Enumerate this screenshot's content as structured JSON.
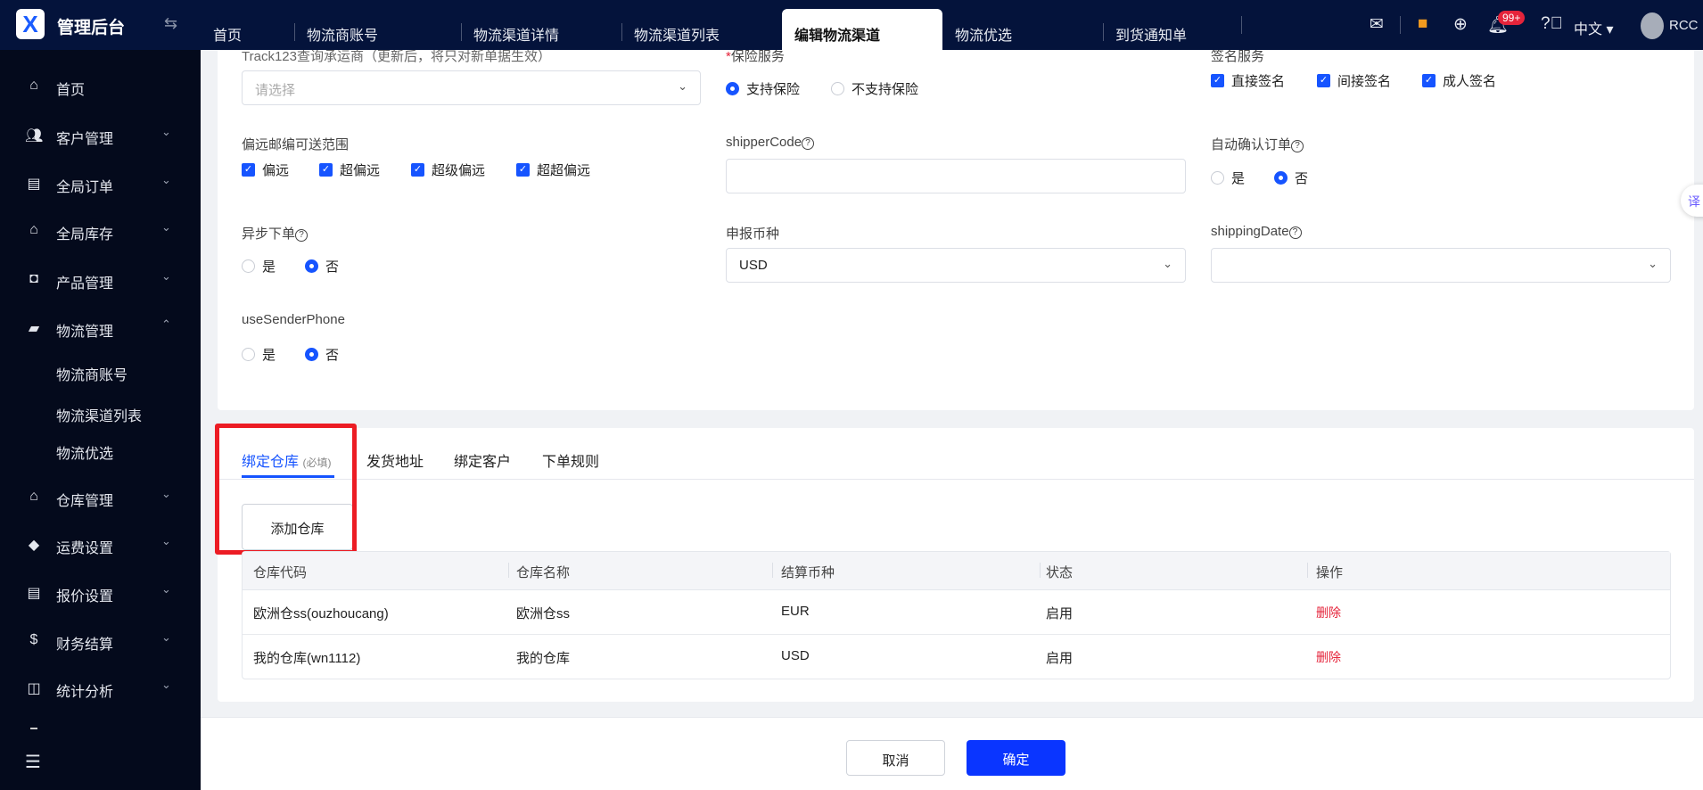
{
  "header": {
    "brand": "管理后台",
    "tabs": [
      "首页",
      "物流商账号",
      "物流渠道详情",
      "物流渠道列表",
      "编辑物流渠道",
      "物流优选",
      "到货通知单"
    ],
    "active_tab": "编辑物流渠道",
    "notification_count": "99+",
    "language": "中文",
    "user": "RCC"
  },
  "sidebar": {
    "items": [
      {
        "label": "首页",
        "icon": "home-icon"
      },
      {
        "label": "客户管理",
        "icon": "users-icon"
      },
      {
        "label": "全局订单",
        "icon": "clipboard-icon"
      },
      {
        "label": "全局库存",
        "icon": "warehouse-icon"
      },
      {
        "label": "产品管理",
        "icon": "bag-icon"
      },
      {
        "label": "物流管理",
        "icon": "truck-icon",
        "expanded": true
      },
      {
        "label": "仓库管理",
        "icon": "house-icon"
      },
      {
        "label": "运费设置",
        "icon": "box-icon"
      },
      {
        "label": "报价设置",
        "icon": "document-icon"
      },
      {
        "label": "财务结算",
        "icon": "dollar-icon"
      },
      {
        "label": "统计分析",
        "icon": "chart-icon"
      }
    ],
    "subitems": [
      "物流商账号",
      "物流渠道列表",
      "物流优选"
    ]
  },
  "form": {
    "track_label": "Track123查询承运商（更新后，将只对新单据生效）",
    "track_placeholder": "请选择",
    "insurance_label": "保险服务",
    "insurance_options": [
      "支持保险",
      "不支持保险"
    ],
    "sign_label": "签名服务",
    "sign_options": [
      "直接签名",
      "间接签名",
      "成人签名"
    ],
    "remote_label": "偏远邮编可送范围",
    "remote_options": [
      "偏远",
      "超偏远",
      "超级偏远",
      "超超偏远"
    ],
    "shipper_label": "shipperCode",
    "shipper_value": "",
    "autoconfirm_label": "自动确认订单",
    "yes": "是",
    "no": "否",
    "async_label": "异步下单",
    "currency_label": "申报币种",
    "currency_value": "USD",
    "shipdate_label": "shippingDate",
    "shipdate_value": "",
    "sender_label": "useSenderPhone"
  },
  "bind": {
    "tabs": [
      "绑定仓库",
      "发货地址",
      "绑定客户",
      "下单规则"
    ],
    "required_note": "(必填)",
    "add_button": "添加仓库",
    "columns": [
      "仓库代码",
      "仓库名称",
      "结算币种",
      "状态",
      "操作"
    ],
    "rows": [
      [
        "欧洲仓ss(ouzhoucang)",
        "欧洲仓ss",
        "EUR",
        "启用",
        "删除"
      ],
      [
        "我的仓库(wn1112)",
        "我的仓库",
        "USD",
        "启用",
        "删除"
      ]
    ]
  },
  "footer": {
    "cancel": "取消",
    "confirm": "确定"
  },
  "translate_bubble": "译"
}
